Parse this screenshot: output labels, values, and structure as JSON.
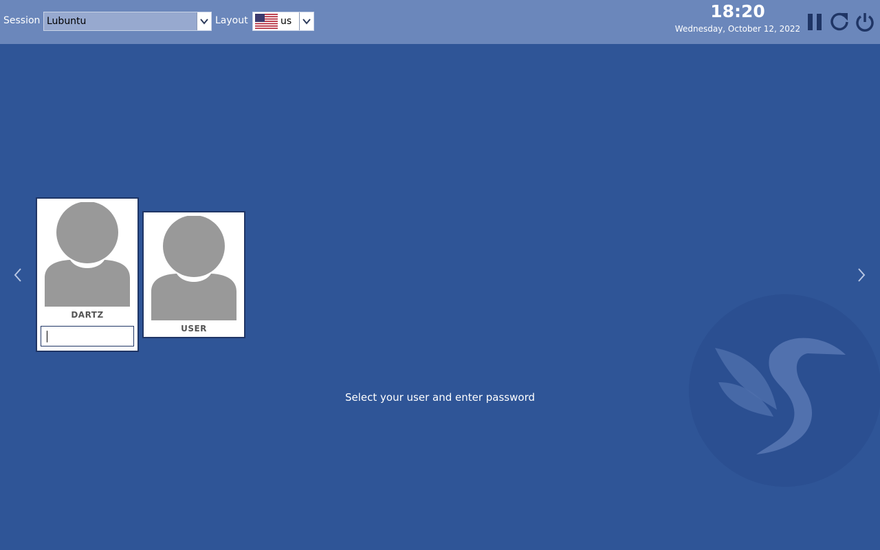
{
  "topbar": {
    "session_label": "Session",
    "session_value": "Lubuntu",
    "layout_label": "Layout",
    "layout_value": "us"
  },
  "clock": {
    "time": "18:20",
    "date": "Wednesday, October 12, 2022"
  },
  "power_icons": [
    "pause-icon",
    "restart-icon",
    "power-icon"
  ],
  "users": [
    {
      "name": "DARTZ",
      "selected": true
    },
    {
      "name": "USER",
      "selected": false
    }
  ],
  "message": "Select your user and enter password",
  "colors": {
    "background": "#2f5597",
    "topbar": "#6b87bb",
    "card_border": "#1f3565",
    "avatar": "#999999"
  }
}
